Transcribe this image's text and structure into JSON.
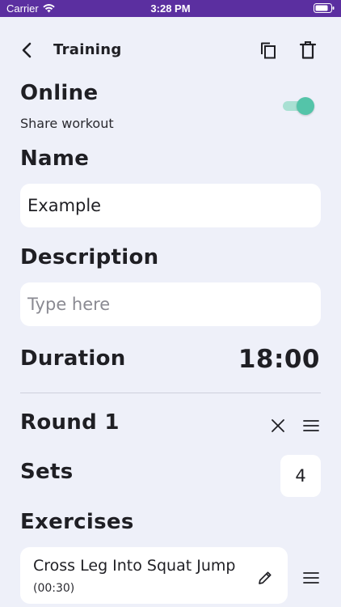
{
  "status_bar": {
    "carrier": "Carrier",
    "time": "3:28 PM",
    "icons": [
      "wifi-icon",
      "battery-icon"
    ]
  },
  "nav": {
    "title": "Training",
    "icons": [
      "back-chevron-icon",
      "copy-icon",
      "trash-icon"
    ]
  },
  "online": {
    "heading": "Online",
    "subtitle": "Share workout",
    "enabled": true
  },
  "name": {
    "heading": "Name",
    "value": "Example"
  },
  "description": {
    "heading": "Description",
    "value": "",
    "placeholder": "Type here"
  },
  "duration": {
    "heading": "Duration",
    "value": "18:00"
  },
  "round": {
    "title": "Round 1",
    "icons": [
      "close-icon",
      "drag-handle-icon"
    ]
  },
  "sets": {
    "heading": "Sets",
    "value": "4"
  },
  "exercises": {
    "heading": "Exercises",
    "items": [
      {
        "name": "Cross Leg Into Squat Jump",
        "duration": "(00:30)"
      }
    ]
  },
  "colors": {
    "status_bar": "#5b2fa0",
    "background": "#eef0f9",
    "toggle_on": "#54c4a9",
    "card": "#ffffff"
  }
}
